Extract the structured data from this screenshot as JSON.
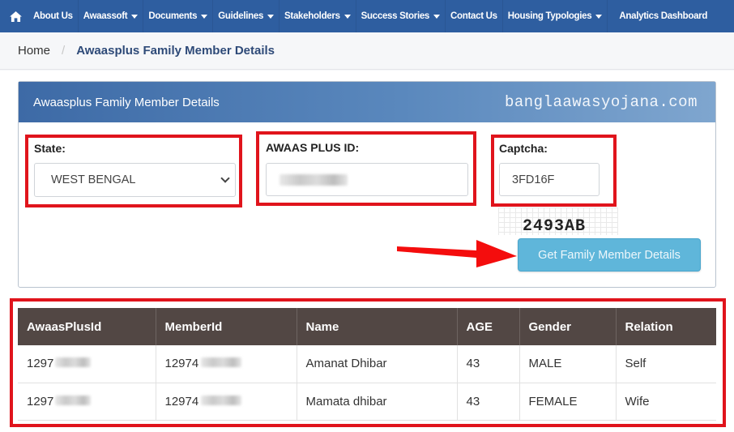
{
  "nav": {
    "home_icon": "home-icon",
    "items": [
      {
        "label": "About Us",
        "dropdown": false
      },
      {
        "label": "Awaassoft",
        "dropdown": true
      },
      {
        "label": "Documents",
        "dropdown": true
      },
      {
        "label": "Guidelines",
        "dropdown": true
      },
      {
        "label": "Stakeholders",
        "dropdown": true
      },
      {
        "label": "Success Stories",
        "dropdown": true
      },
      {
        "label": "Contact Us",
        "dropdown": false
      },
      {
        "label": "Housing Typologies",
        "dropdown": true
      },
      {
        "label": "Analytics Dashboard",
        "dropdown": false
      }
    ]
  },
  "breadcrumb": {
    "home": "Home",
    "separator": "/",
    "current": "Awaasplus Family Member Details"
  },
  "panel": {
    "title": "Awaasplus Family Member Details",
    "watermark": "banglaawasyojana.com"
  },
  "form": {
    "state_label": "State:",
    "state_value": "WEST BENGAL",
    "awaas_id_label": "AWAAS PLUS ID:",
    "awaas_id_value": "",
    "captcha_label": "Captcha:",
    "captcha_input_value": "3FD16F",
    "captcha_image_text": "2493AB",
    "submit_label": "Get Family Member Details"
  },
  "table": {
    "headers": [
      "AwaasPlusId",
      "MemberId",
      "Name",
      "AGE",
      "Gender",
      "Relation"
    ],
    "rows": [
      {
        "awaas_plus_id": "1297",
        "member_id": "12974",
        "name": "Amanat Dhibar",
        "age": "43",
        "gender": "MALE",
        "relation": "Self"
      },
      {
        "awaas_plus_id": "1297",
        "member_id": "12974",
        "name": "Mamata dhibar",
        "age": "43",
        "gender": "FEMALE",
        "relation": "Wife"
      }
    ]
  },
  "colors": {
    "nav_bg": "#2e5ea0",
    "highlight_red": "#e0141c",
    "button_bg": "#5fb6da",
    "table_header_bg": "#524744"
  }
}
